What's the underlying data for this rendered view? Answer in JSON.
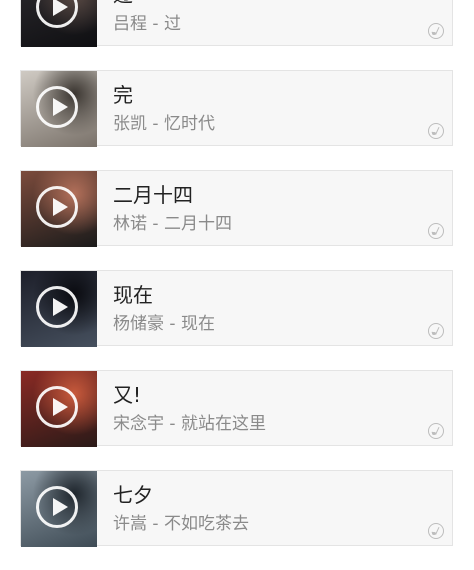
{
  "songs": [
    {
      "title": "过",
      "subtitle": "吕程 - 过",
      "cover_colors": [
        "#2c2a2e",
        "#0f0f12",
        "#5a4a44"
      ]
    },
    {
      "title": "完",
      "subtitle": "张凯 - 忆时代",
      "cover_colors": [
        "#cfcac3",
        "#7a726a",
        "#3a3530"
      ]
    },
    {
      "title": "二月十四",
      "subtitle": "林诺 - 二月十四",
      "cover_colors": [
        "#7b4b3c",
        "#1b1b1b",
        "#b3705a"
      ]
    },
    {
      "title": "现在",
      "subtitle": "杨储豪 - 现在",
      "cover_colors": [
        "#1d1f2a",
        "#46505e",
        "#0a0b10"
      ]
    },
    {
      "title": "又!",
      "subtitle": "宋念宇 - 就站在这里",
      "cover_colors": [
        "#8a2a24",
        "#2a1a18",
        "#c85a3c"
      ]
    },
    {
      "title": "七夕",
      "subtitle": "许嵩 - 不如吃茶去",
      "cover_colors": [
        "#8d9aa4",
        "#3e4b55",
        "#1f262d"
      ]
    }
  ]
}
